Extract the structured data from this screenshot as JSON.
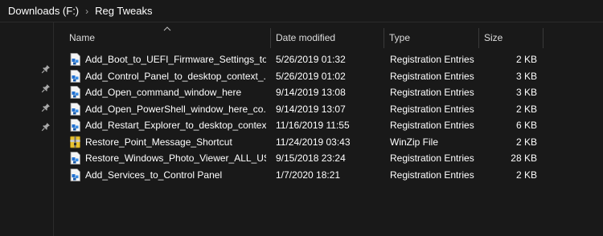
{
  "breadcrumb": {
    "items": [
      "Downloads (F:)",
      "Reg Tweaks"
    ],
    "separator": "›"
  },
  "columns": {
    "name": "Name",
    "date": "Date modified",
    "type": "Type",
    "size": "Size"
  },
  "files": [
    {
      "name": "Add_Boot_to_UEFI_Firmware_Settings_to...",
      "date": "5/26/2019 01:32",
      "type": "Registration Entries",
      "size": "2 KB",
      "icon": "reg-file-icon"
    },
    {
      "name": "Add_Control_Panel_to_desktop_context_...",
      "date": "5/26/2019 01:02",
      "type": "Registration Entries",
      "size": "3 KB",
      "icon": "reg-file-icon"
    },
    {
      "name": "Add_Open_command_window_here",
      "date": "9/14/2019 13:08",
      "type": "Registration Entries",
      "size": "3 KB",
      "icon": "reg-file-icon"
    },
    {
      "name": "Add_Open_PowerShell_window_here_co...",
      "date": "9/14/2019 13:07",
      "type": "Registration Entries",
      "size": "2 KB",
      "icon": "reg-file-icon"
    },
    {
      "name": "Add_Restart_Explorer_to_desktop_contex...",
      "date": "11/16/2019 11:55",
      "type": "Registration Entries",
      "size": "6 KB",
      "icon": "reg-file-icon"
    },
    {
      "name": "Restore_Point_Message_Shortcut",
      "date": "11/24/2019 03:43",
      "type": "WinZip File",
      "size": "2 KB",
      "icon": "zip-file-icon"
    },
    {
      "name": "Restore_Windows_Photo_Viewer_ALL_US...",
      "date": "9/15/2018 23:24",
      "type": "Registration Entries",
      "size": "28 KB",
      "icon": "reg-file-icon"
    },
    {
      "name": "Add_Services_to_Control Panel",
      "date": "1/7/2020 18:21",
      "type": "Registration Entries",
      "size": "2 KB",
      "icon": "reg-file-icon"
    }
  ],
  "colors": {
    "background": "#191919",
    "text": "#ffffff",
    "header_text": "#dcdcdc",
    "separator": "#3a3a3a"
  }
}
